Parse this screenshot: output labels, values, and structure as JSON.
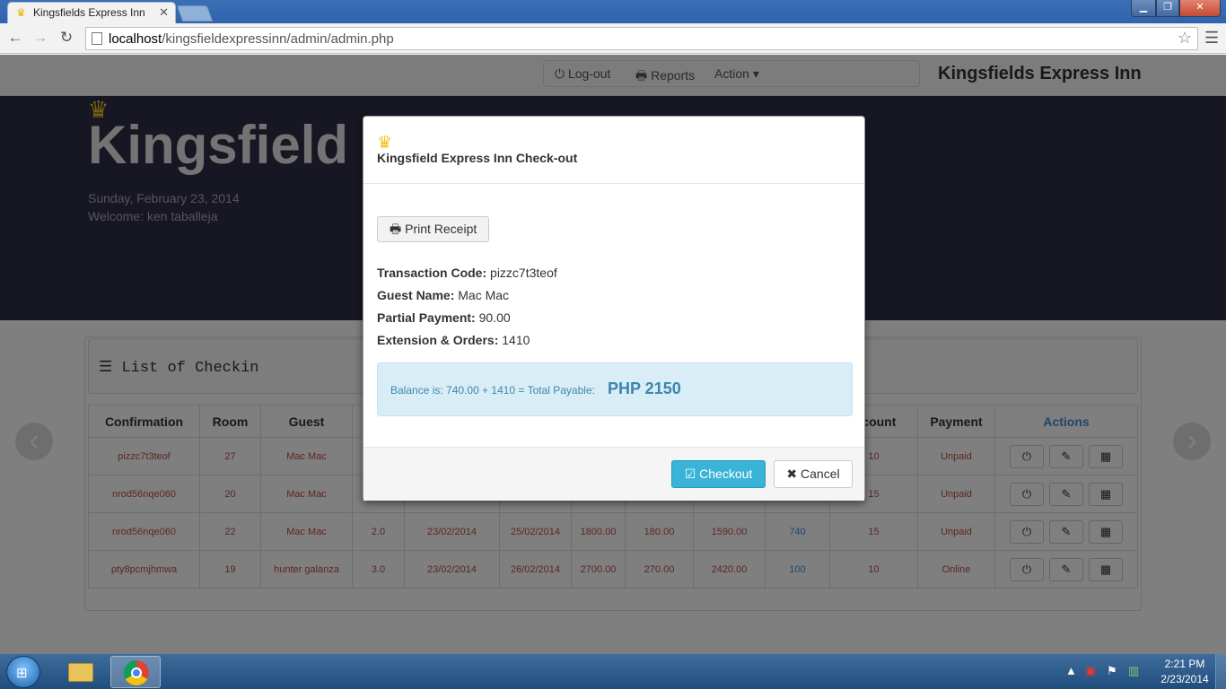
{
  "browser": {
    "tab_title": "Kingsfields Express Inn",
    "tab_close": "✕",
    "url_host": "localhost",
    "url_path": "/kingsfieldexpressinn/admin/admin.php"
  },
  "navbar": {
    "logout_label": "Log-out",
    "reports_label": "Reports",
    "action_label": "Action",
    "brand": "Kingsfields Express Inn"
  },
  "hero": {
    "title": "Kingsfield I",
    "date": "Sunday, February 23, 2014",
    "welcome": "Welcome:  ken taballeja"
  },
  "panel": {
    "title": "List of Checkin",
    "columns": [
      "Confirmation",
      "Room",
      "Guest",
      "",
      "",
      "",
      "",
      "",
      "",
      "",
      "iscount",
      "Payment",
      "Actions"
    ],
    "rows": [
      [
        "pizzc7t3teof",
        "27",
        "Mac Mac",
        "",
        "",
        "",
        "",
        "",
        "",
        "",
        "10",
        "Unpaid"
      ],
      [
        "nrod56nqe060",
        "20",
        "Mac Mac",
        "",
        "",
        "",
        "",
        "",
        "",
        "",
        "15",
        "Unpaid"
      ],
      [
        "nrod56nqe060",
        "22",
        "Mac Mac",
        "2.0",
        "23/02/2014",
        "25/02/2014",
        "1800.00",
        "180.00",
        "1590.00",
        "740",
        "15",
        "Unpaid"
      ],
      [
        "pty8pcmjhmwa",
        "19",
        "hunter galanza",
        "3.0",
        "23/02/2014",
        "26/02/2014",
        "2700.00",
        "270.00",
        "2420.00",
        "100",
        "10",
        "Online"
      ]
    ]
  },
  "modal": {
    "title": "Kingsfield Express Inn Check-out",
    "print_label": "Print Receipt",
    "transaction_label": "Transaction Code:",
    "transaction_value": "pizzc7t3teof",
    "guest_label": "Guest Name:",
    "guest_value": "Mac Mac",
    "partial_label": "Partial Payment:",
    "partial_value": "90.00",
    "extension_label": "Extension & Orders:",
    "extension_value": "1410",
    "balance_text": "Balance is: 740.00 + 1410 = Total Payable:",
    "total_payable": "PHP 2150",
    "checkout_label": "Checkout",
    "cancel_label": "Cancel"
  },
  "taskbar": {
    "time": "2:21 PM",
    "date": "2/23/2014"
  },
  "icons": [
    "crown-icon",
    "power-icon",
    "print-icon",
    "edit-icon",
    "grid-icon",
    "list-icon",
    "check-icon",
    "close-icon"
  ]
}
